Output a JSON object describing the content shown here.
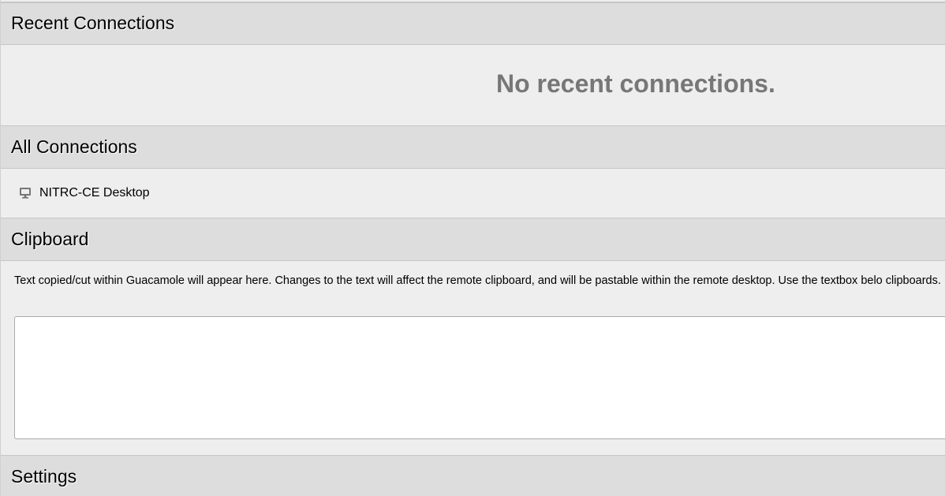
{
  "recent": {
    "title": "Recent Connections",
    "empty_message": "No recent connections."
  },
  "all_connections": {
    "title": "All Connections",
    "items": [
      {
        "icon": "monitor-icon",
        "label": "NITRC-CE Desktop"
      }
    ]
  },
  "clipboard": {
    "title": "Clipboard",
    "description": "Text copied/cut within Guacamole will appear here. Changes to the text will affect the remote clipboard, and will be pastable within the remote desktop. Use the textbox belo clipboards.",
    "value": ""
  },
  "settings": {
    "title": "Settings"
  },
  "colors": {
    "header_bg": "#dddddd",
    "body_bg": "#eeeeee",
    "muted_text": "#777777"
  }
}
